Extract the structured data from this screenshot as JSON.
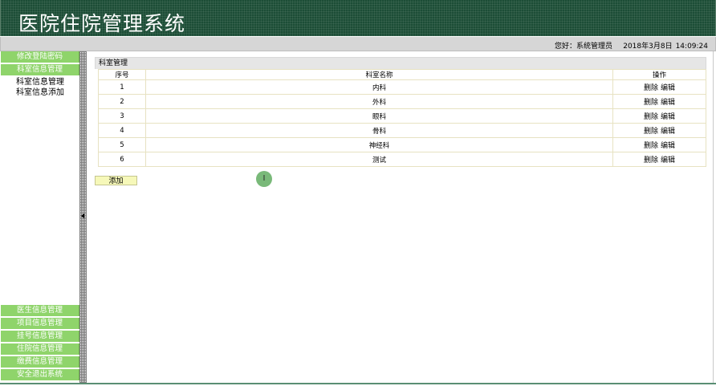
{
  "header": {
    "title": "医院住院管理系统"
  },
  "status": {
    "greeting": "您好：系统管理员",
    "date": "2018年3月8日",
    "time": "14:09:24"
  },
  "sidebar": {
    "top_items": [
      {
        "label": "修改登陆密码"
      },
      {
        "label": "科室信息管理"
      }
    ],
    "sub_items": [
      {
        "label": "科室信息管理"
      },
      {
        "label": "科室信息添加"
      }
    ],
    "bottom_items": [
      {
        "label": "医生信息管理"
      },
      {
        "label": "项目信息管理"
      },
      {
        "label": "挂号信息管理"
      },
      {
        "label": "住院信息管理"
      },
      {
        "label": "缴费信息管理"
      },
      {
        "label": "安全退出系统"
      }
    ]
  },
  "panel": {
    "title": "科室管理",
    "columns": {
      "no": "序号",
      "name": "科室名称",
      "op": "操作"
    },
    "rows": [
      {
        "no": "1",
        "name": "内科",
        "delete": "删除",
        "edit": "编辑"
      },
      {
        "no": "2",
        "name": "外科",
        "delete": "删除",
        "edit": "编辑"
      },
      {
        "no": "3",
        "name": "眼科",
        "delete": "删除",
        "edit": "编辑"
      },
      {
        "no": "4",
        "name": "骨科",
        "delete": "删除",
        "edit": "编辑"
      },
      {
        "no": "5",
        "name": "神经科",
        "delete": "删除",
        "edit": "编辑"
      },
      {
        "no": "6",
        "name": "测试",
        "delete": "删除",
        "edit": "编辑"
      }
    ],
    "add_label": "添加"
  },
  "colors": {
    "banner": "#1c4d36",
    "nav": "#8fd46b",
    "add_button": "#f6f8b9"
  },
  "icons": {
    "cursor": "text-cursor-icon",
    "splitter_arrow": "collapse-left-icon"
  }
}
